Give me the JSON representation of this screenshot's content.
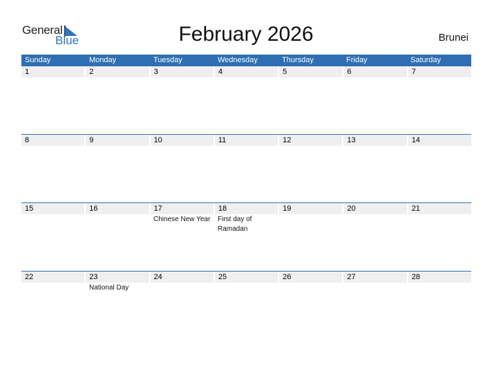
{
  "logo": {
    "general": "General",
    "blue": "Blue"
  },
  "title": "February 2026",
  "country": "Brunei",
  "colors": {
    "accent": "#2e6fb3",
    "cell_bg": "#efefef"
  },
  "days": [
    "Sunday",
    "Monday",
    "Tuesday",
    "Wednesday",
    "Thursday",
    "Friday",
    "Saturday"
  ],
  "weeks": [
    {
      "dates": [
        "1",
        "2",
        "3",
        "4",
        "5",
        "6",
        "7"
      ],
      "holidays": [
        "",
        "",
        "",
        "",
        "",
        "",
        ""
      ]
    },
    {
      "dates": [
        "8",
        "9",
        "10",
        "11",
        "12",
        "13",
        "14"
      ],
      "holidays": [
        "",
        "",
        "",
        "",
        "",
        "",
        ""
      ]
    },
    {
      "dates": [
        "15",
        "16",
        "17",
        "18",
        "19",
        "20",
        "21"
      ],
      "holidays": [
        "",
        "",
        "Chinese New Year",
        "First day of Ramadan",
        "",
        "",
        ""
      ]
    },
    {
      "dates": [
        "22",
        "23",
        "24",
        "25",
        "26",
        "27",
        "28"
      ],
      "holidays": [
        "",
        "National Day",
        "",
        "",
        "",
        "",
        ""
      ]
    }
  ]
}
